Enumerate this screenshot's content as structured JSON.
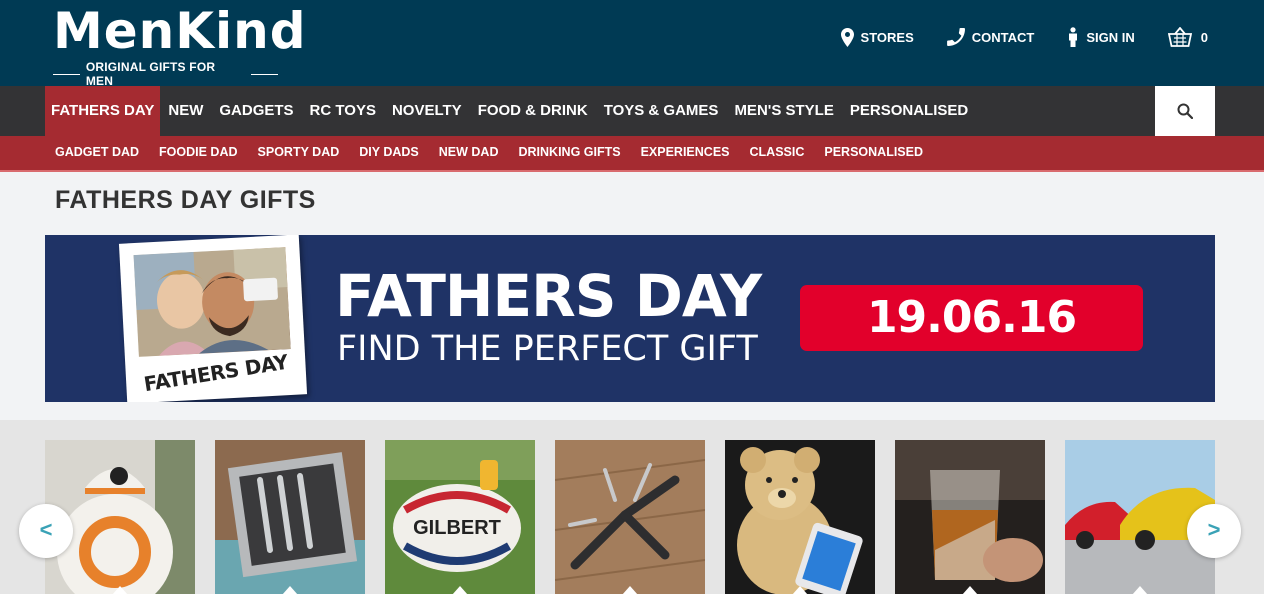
{
  "brand": {
    "name": "MenKind",
    "tagline": "ORIGINAL GIFTS FOR MEN"
  },
  "top_links": {
    "stores": "STORES",
    "contact": "CONTACT",
    "sign_in": "SIGN IN",
    "basket_count": "0"
  },
  "main_nav": [
    "FATHERS DAY",
    "NEW",
    "GADGETS",
    "RC TOYS",
    "NOVELTY",
    "FOOD & DRINK",
    "TOYS & GAMES",
    "MEN'S STYLE",
    "PERSONALISED"
  ],
  "sub_nav": [
    "GADGET DAD",
    "FOODIE DAD",
    "SPORTY DAD",
    "DIY DADS",
    "NEW DAD",
    "DRINKING GIFTS",
    "EXPERIENCES",
    "CLASSIC",
    "PERSONALISED"
  ],
  "page_title": "FATHERS DAY GIFTS",
  "banner": {
    "polaroid_caption": "FATHERS DAY",
    "headline": "FATHERS DAY",
    "subline": "FIND THE PERFECT GIFT",
    "date": "19.06.16"
  },
  "carousel": {
    "prev": "<",
    "next": ">"
  },
  "colors": {
    "header": "#003a54",
    "nav": "#333335",
    "accent": "#a52b31",
    "banner": "#1f3366",
    "date_pill": "#e2002b"
  }
}
